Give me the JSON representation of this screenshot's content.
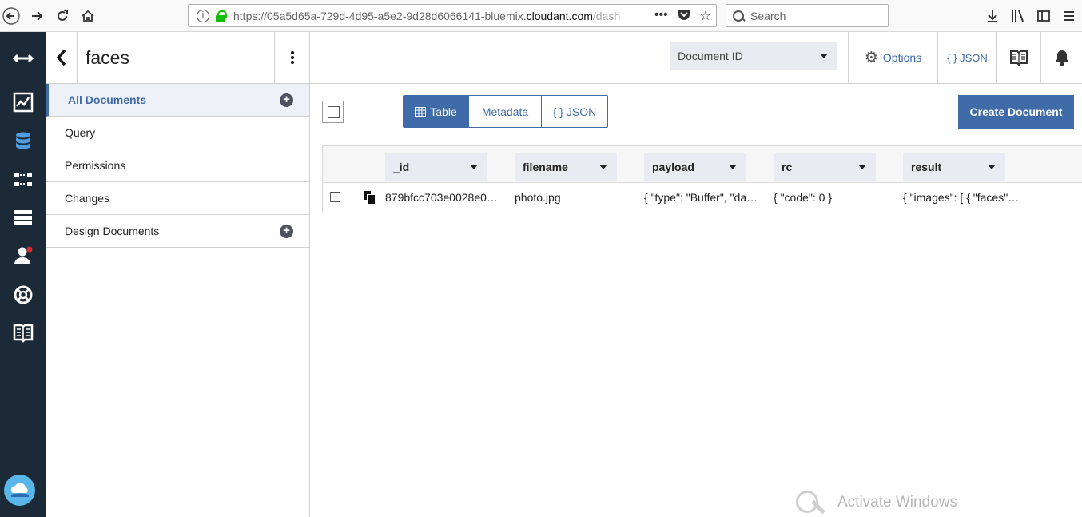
{
  "browser": {
    "url_prefix": "https://05a5d65a-729d-4d95-a5e2-9d28d6066141-bluemix.",
    "url_domain": "cloudant.com",
    "url_path": "/dash",
    "search_placeholder": "Search"
  },
  "sidebar": {
    "title": "faces",
    "items": [
      {
        "label": "All Documents"
      },
      {
        "label": "Query"
      },
      {
        "label": "Permissions"
      },
      {
        "label": "Changes"
      },
      {
        "label": "Design Documents"
      }
    ]
  },
  "header": {
    "doc_select": "Document ID",
    "options_label": "Options",
    "json_label": "{ } JSON"
  },
  "toolbar": {
    "tabs": [
      {
        "label": "Table",
        "active": true
      },
      {
        "label": "Metadata",
        "active": false
      },
      {
        "label": "{ } JSON",
        "active": false
      }
    ],
    "create_label": "Create Document"
  },
  "table": {
    "columns": [
      "_id",
      "filename",
      "payload",
      "rc",
      "result"
    ],
    "rows": [
      {
        "_id": "879bfcc703e0028e0…",
        "filename": "photo.jpg",
        "payload": "{ \"type\": \"Buffer\", \"da…",
        "rc": "{ \"code\": 0 }",
        "result": "{ \"images\": [ { \"faces\"…"
      }
    ]
  },
  "watermark": "Activate Windows",
  "colors": {
    "accent": "#3f6ba8",
    "rail": "#1c2a38"
  }
}
